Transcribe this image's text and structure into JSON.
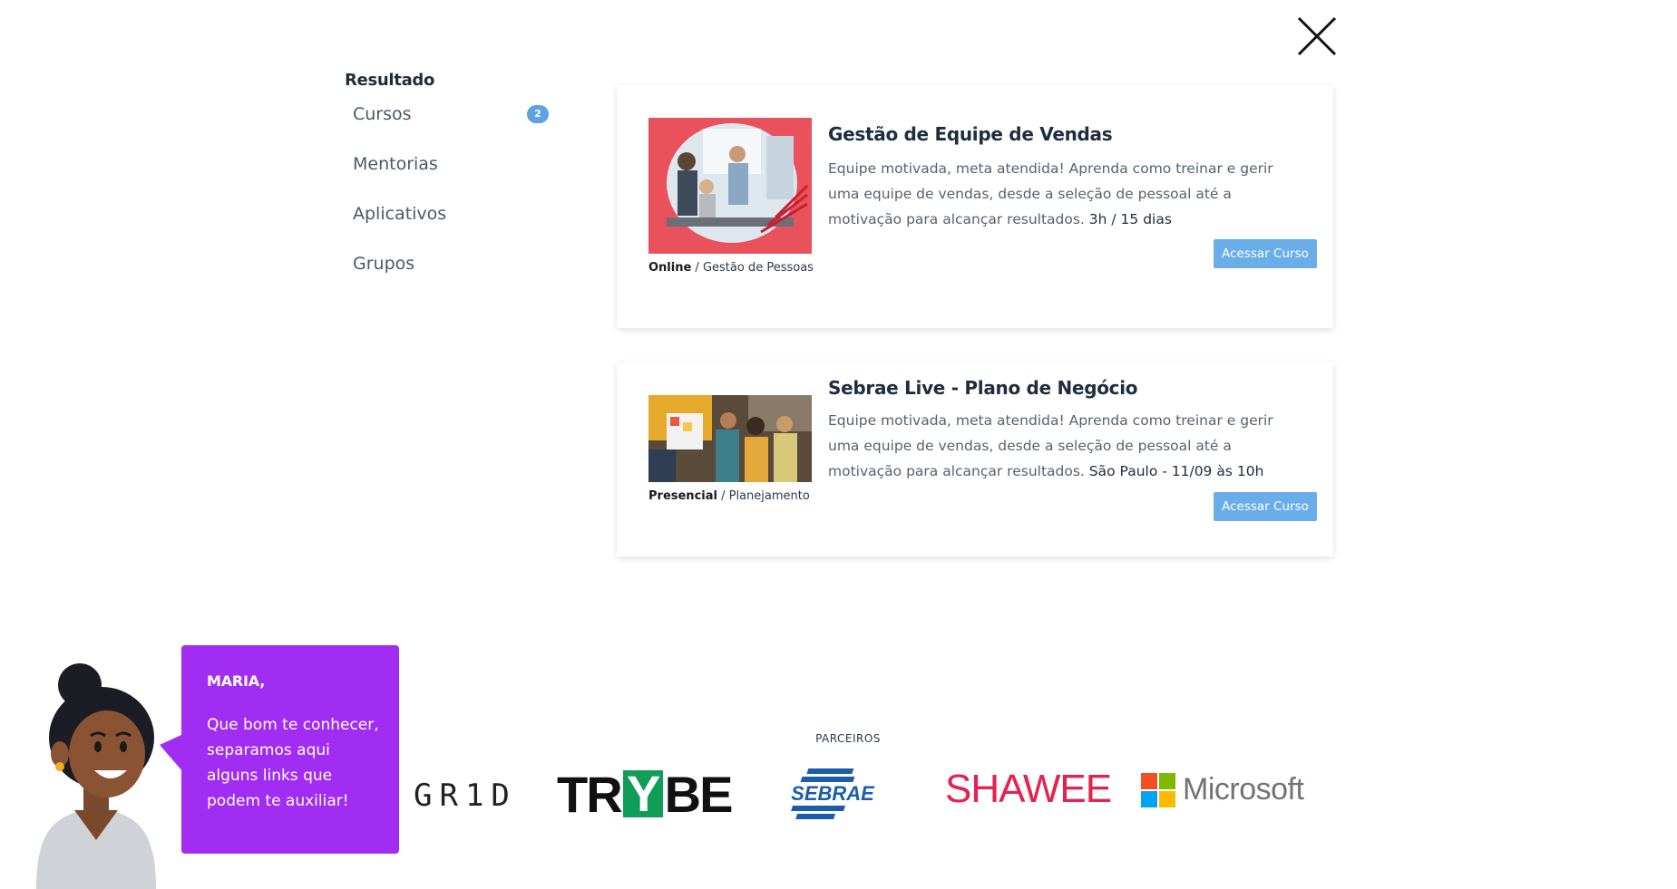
{
  "sidebar": {
    "title": "Resultado",
    "items": [
      {
        "label": "Cursos",
        "badge": "2"
      },
      {
        "label": "Mentorias"
      },
      {
        "label": "Aplicativos"
      },
      {
        "label": "Grupos"
      }
    ]
  },
  "results": [
    {
      "title": "Gestão de Equipe de Vendas",
      "description": "Equipe motivada, meta atendida! Aprenda como treinar e gerir uma equipe de vendas, desde a seleção de pessoal até a motivação para alcançar resultados.",
      "extra": "3h / 15 dias",
      "mode": "Online",
      "category": " / Gestão de Pessoas",
      "button": "Acessar Curso"
    },
    {
      "title": "Sebrae Live - Plano de Negócio",
      "description": "Equipe motivada, meta atendida! Aprenda como treinar e gerir uma equipe de vendas, desde a seleção de pessoal até a motivação para alcançar resultados.",
      "extra": "São Paulo - 11/09 às 10h",
      "mode": "Presencial",
      "category": " / Planejamento",
      "button": "Acessar Curso"
    }
  ],
  "assistant": {
    "name": "MARIA,",
    "message": "Que bom te conhecer, separamos aqui alguns links que podem te auxiliar!"
  },
  "partners": {
    "label": "PARCEIROS",
    "logos": {
      "grid": "GR1D",
      "trybe_left": "TR",
      "trybe_y": "Y",
      "trybe_right": "BE",
      "sebrae": "SEBRAE",
      "shawee": "SHAWEE",
      "microsoft": "Microsoft"
    }
  },
  "colors": {
    "accent": "#6aaee9",
    "badge": "#5ea2e5",
    "bubble": "#a12cf2",
    "shawee": "#e5214f",
    "trybe_y": "#0f9d58",
    "sebrae": "#1a5dad"
  },
  "icons": {
    "close": "close-icon"
  }
}
